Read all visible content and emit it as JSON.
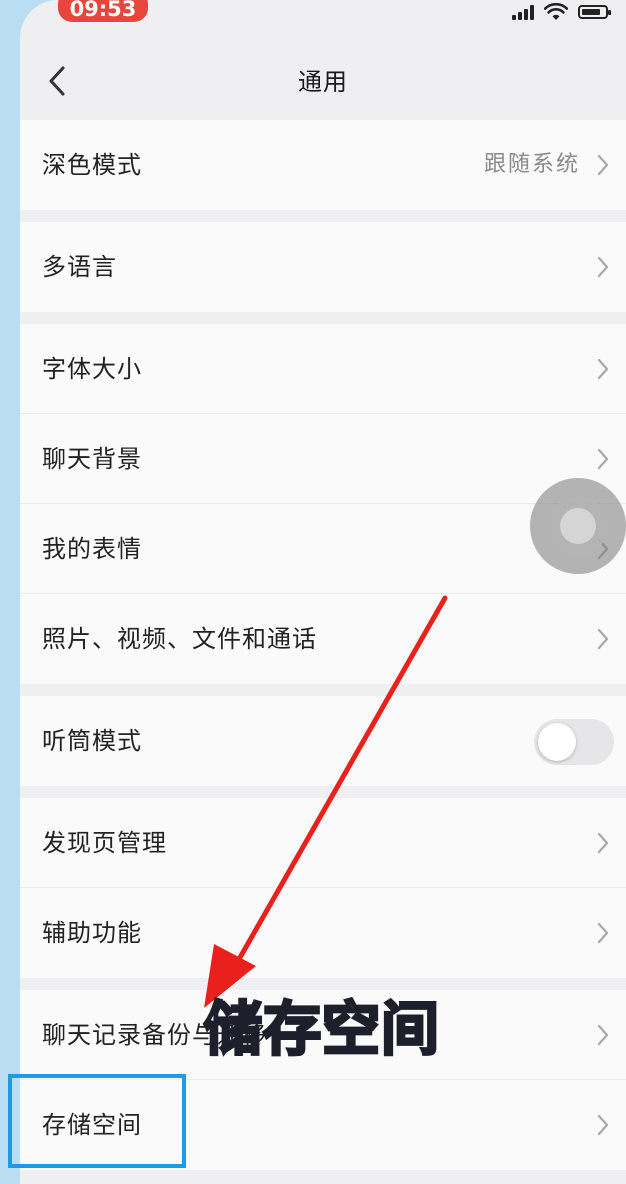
{
  "status_bar": {
    "time": "09:53"
  },
  "nav": {
    "title": "通用"
  },
  "groups": [
    [
      {
        "label": "深色模式",
        "value": "跟随系统"
      }
    ],
    [
      {
        "label": "多语言"
      }
    ],
    [
      {
        "label": "字体大小"
      },
      {
        "label": "聊天背景"
      },
      {
        "label": "我的表情"
      },
      {
        "label": "照片、视频、文件和通话"
      }
    ],
    [
      {
        "label": "听筒模式",
        "toggle": false
      }
    ],
    [
      {
        "label": "发现页管理"
      },
      {
        "label": "辅助功能"
      }
    ],
    [
      {
        "label": "聊天记录备份与迁移"
      },
      {
        "label": "存储空间"
      }
    ]
  ],
  "overlay": {
    "caption": "储存空间"
  },
  "colors": {
    "accent_highlight": "#1e9ae6",
    "arrow": "#e8211c",
    "status_pill": "#e8453c"
  }
}
